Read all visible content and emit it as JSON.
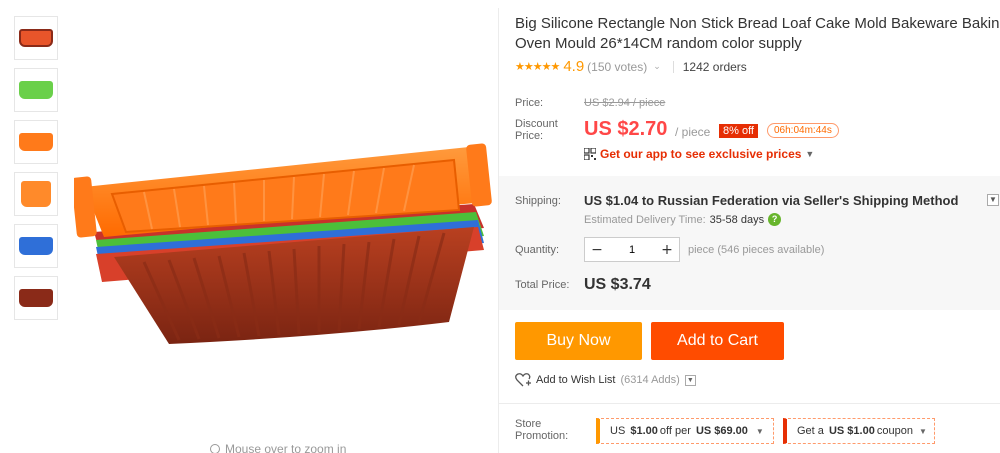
{
  "thumbnails": [
    {
      "color": "#e8552a",
      "shape": "mold-icon"
    },
    {
      "color": "#6ad04a",
      "shape": "mold-icon"
    },
    {
      "color": "#ff7a1a",
      "shape": "mold-icon"
    },
    {
      "color": "#ff8a2a",
      "shape": "mold-icon"
    },
    {
      "color": "#2f6fd8",
      "shape": "mold-icon"
    },
    {
      "color": "#8a2a18",
      "shape": "mold-icon"
    }
  ],
  "zoom_hint": "Mouse over to zoom in",
  "product": {
    "title_line1": "Big Silicone Rectangle Non Stick Bread Loaf Cake Mold Bakeware Baking Pan",
    "title_line2": "Oven Mould 26*14CM random color supply",
    "stars": "★★★★★",
    "rating": "4.9",
    "votes": "(150 votes)",
    "orders": "1242 orders"
  },
  "price": {
    "label": "Price:",
    "original": "US $2.94 / piece",
    "discount_label": "Discount Price:",
    "discount_value": "US $2.70",
    "per": "/ piece",
    "off_badge": "8% off",
    "timer": "06h:04m:44s",
    "app_link": "Get our app to see exclusive prices"
  },
  "shipping": {
    "label": "Shipping:",
    "value": "US $1.04 to Russian Federation via Seller's Shipping Method",
    "delivery_prefix": "Estimated Delivery Time:",
    "delivery_days": "35-58 days"
  },
  "quantity": {
    "label": "Quantity:",
    "value": "1",
    "minus": "−",
    "plus": "+",
    "note": "piece (546 pieces available)"
  },
  "total": {
    "label": "Total Price:",
    "value": "US $3.74"
  },
  "actions": {
    "buy_now": "Buy Now",
    "add_to_cart": "Add to Cart",
    "wishlist": "Add to Wish List",
    "wishlist_count": "(6314 Adds)"
  },
  "store_promotion": {
    "label": "Store Promotion:",
    "coupon1_pre": "US",
    "coupon1_amount": "$1.00",
    "coupon1_mid": "off per",
    "coupon1_threshold": "US $69.00",
    "coupon2_pre": "Get a",
    "coupon2_amount": "US $1.00",
    "coupon2_post": "coupon"
  },
  "colors": {
    "accent_red": "#ff4747",
    "buy_now": "#ff9800",
    "add_to_cart": "#ff4c00",
    "star": "#ff9800"
  }
}
